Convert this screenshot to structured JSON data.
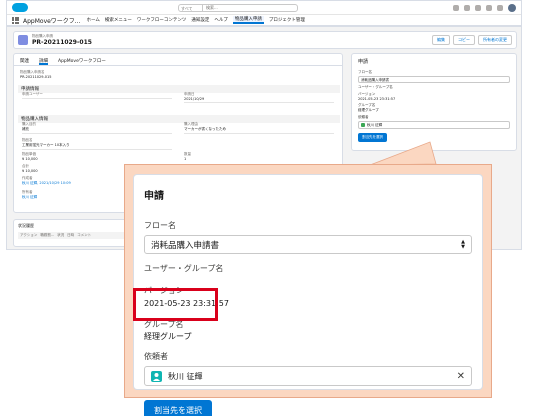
{
  "topbar": {
    "search_scope": "すべて",
    "search_placeholder": "検索..."
  },
  "navbar": {
    "app_name": "AppMoveワークフ...",
    "items": [
      "ホーム",
      "検索メニュー",
      "ワークフローコンテンツ",
      "通知設定",
      "ヘルプ",
      "物品購入申請",
      "プロジェクト管理"
    ],
    "active_index": 5
  },
  "record": {
    "type": "物品購入申請",
    "title": "PR-20211029-015",
    "buttons": [
      "編集",
      "コピー",
      "所有者の変更"
    ]
  },
  "detail": {
    "tabs": [
      "関連",
      "詳細",
      "AppMoveワークフロー"
    ],
    "active_tab": 1,
    "record_number_label": "物品購入申請名",
    "record_number": "PR-20211029-015",
    "section_request": "申請情報",
    "applicant_label": "申請ユーザー",
    "date_label": "申請日",
    "date_value": "2021/10/29",
    "section_item": "物品購入情報",
    "purchase_label": "購入目的",
    "purchase_value": "補充",
    "reason_label": "購入理由",
    "reason_value": "マーカーが書くなったため",
    "item_label": "物品名",
    "item_value": "工業用蛍光マーカー 10本入り",
    "price_label": "物品単価",
    "price_value": "¥ 10,000",
    "qty_label": "数量",
    "qty_value": "1",
    "total_label": "合計",
    "total_value": "¥ 10,000",
    "creator_label": "作成者",
    "creator_value": "秋川 征輝, 2021/10/29 10:09",
    "owner_label": "所有者",
    "owner_value": "秋川 征輝"
  },
  "history": {
    "title": "状況履歴",
    "columns": [
      "アクション",
      "職務割...",
      "状況",
      "日時",
      "コメント"
    ]
  },
  "panel_small": {
    "title": "申請",
    "flow_label": "フロー名",
    "flow_value": "消耗品購入申請書",
    "group_label": "ユーザー・グループ名",
    "version_label": "バージョン",
    "version_value": "2021-05-23 23:31:57",
    "groupname_label": "グループ名",
    "groupname_value": "経理グループ",
    "requester_label": "依頼者",
    "requester_value": "秋川 征輝",
    "button": "割当先を選択"
  },
  "zoom": {
    "title": "申請",
    "flow_label": "フロー名",
    "flow_value": "消耗品購入申請書",
    "group_label": "ユーザー・グループ名",
    "version_label": "バージョン",
    "version_value": "2021-05-23 23:31:57",
    "groupname_label": "グループ名",
    "groupname_value": "経理グループ",
    "requester_label": "依頼者",
    "requester_value": "秋川 征輝",
    "button": "割当先を選択"
  },
  "colors": {
    "brand": "#0176d3",
    "highlight": "#d9001b",
    "callout": "#fbd7c1",
    "user_icon": "#0fb5b2"
  }
}
